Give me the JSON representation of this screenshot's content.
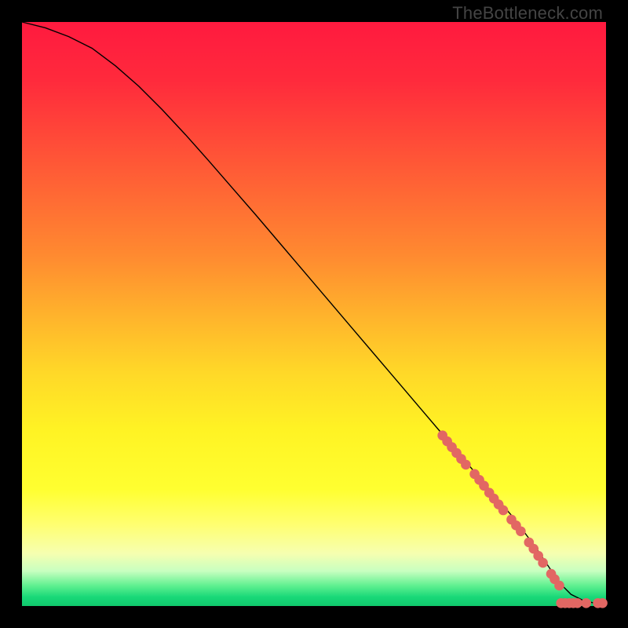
{
  "watermark": "TheBottleneck.com",
  "chart_data": {
    "type": "line",
    "title": "",
    "xlabel": "",
    "ylabel": "",
    "xlim": [
      0,
      100
    ],
    "ylim": [
      0,
      100
    ],
    "curve": {
      "name": "bottleneck-curve",
      "x": [
        0,
        4,
        8,
        12,
        16,
        20,
        24,
        28,
        32,
        36,
        40,
        44,
        48,
        52,
        56,
        60,
        64,
        68,
        72,
        76,
        80,
        84,
        88,
        90,
        92,
        94,
        96,
        98,
        100
      ],
      "y": [
        100,
        99,
        97.5,
        95.5,
        92.5,
        89,
        85,
        80.7,
        76.2,
        71.6,
        67,
        62.3,
        57.6,
        52.9,
        48.2,
        43.5,
        38.8,
        34.1,
        29.4,
        24.7,
        20,
        15.3,
        10,
        7,
        4,
        2,
        1,
        0.5,
        0.3
      ]
    },
    "highlight_points": {
      "name": "highlight-markers",
      "color": "#e26763",
      "points": [
        {
          "x": 72.0,
          "y": 29.2
        },
        {
          "x": 72.8,
          "y": 28.2
        },
        {
          "x": 73.6,
          "y": 27.2
        },
        {
          "x": 74.4,
          "y": 26.2
        },
        {
          "x": 75.2,
          "y": 25.2
        },
        {
          "x": 76.0,
          "y": 24.2
        },
        {
          "x": 77.5,
          "y": 22.6
        },
        {
          "x": 78.3,
          "y": 21.6
        },
        {
          "x": 79.1,
          "y": 20.6
        },
        {
          "x": 80.0,
          "y": 19.4
        },
        {
          "x": 80.8,
          "y": 18.4
        },
        {
          "x": 81.6,
          "y": 17.4
        },
        {
          "x": 82.4,
          "y": 16.4
        },
        {
          "x": 83.8,
          "y": 14.8
        },
        {
          "x": 84.6,
          "y": 13.8
        },
        {
          "x": 85.4,
          "y": 12.8
        },
        {
          "x": 86.8,
          "y": 10.9
        },
        {
          "x": 87.6,
          "y": 9.8
        },
        {
          "x": 88.4,
          "y": 8.6
        },
        {
          "x": 89.2,
          "y": 7.4
        },
        {
          "x": 90.6,
          "y": 5.5
        },
        {
          "x": 91.2,
          "y": 4.6
        },
        {
          "x": 92.0,
          "y": 3.5
        },
        {
          "x": 92.3,
          "y": 0.5
        },
        {
          "x": 93.0,
          "y": 0.5
        },
        {
          "x": 93.7,
          "y": 0.5
        },
        {
          "x": 94.4,
          "y": 0.5
        },
        {
          "x": 95.1,
          "y": 0.5
        },
        {
          "x": 96.6,
          "y": 0.5
        },
        {
          "x": 98.6,
          "y": 0.5
        },
        {
          "x": 99.4,
          "y": 0.5
        }
      ]
    },
    "gradient_stops": [
      {
        "offset": 0.0,
        "color": "#ff1a3f"
      },
      {
        "offset": 0.1,
        "color": "#ff2a3c"
      },
      {
        "offset": 0.2,
        "color": "#ff4a38"
      },
      {
        "offset": 0.3,
        "color": "#ff6a34"
      },
      {
        "offset": 0.4,
        "color": "#ff8a30"
      },
      {
        "offset": 0.5,
        "color": "#ffb22c"
      },
      {
        "offset": 0.6,
        "color": "#ffd828"
      },
      {
        "offset": 0.7,
        "color": "#fff324"
      },
      {
        "offset": 0.8,
        "color": "#ffff30"
      },
      {
        "offset": 0.86,
        "color": "#ffff70"
      },
      {
        "offset": 0.91,
        "color": "#f6ffb0"
      },
      {
        "offset": 0.94,
        "color": "#c8ffc0"
      },
      {
        "offset": 0.965,
        "color": "#60f090"
      },
      {
        "offset": 0.985,
        "color": "#18d878"
      },
      {
        "offset": 1.0,
        "color": "#10c86c"
      }
    ]
  }
}
